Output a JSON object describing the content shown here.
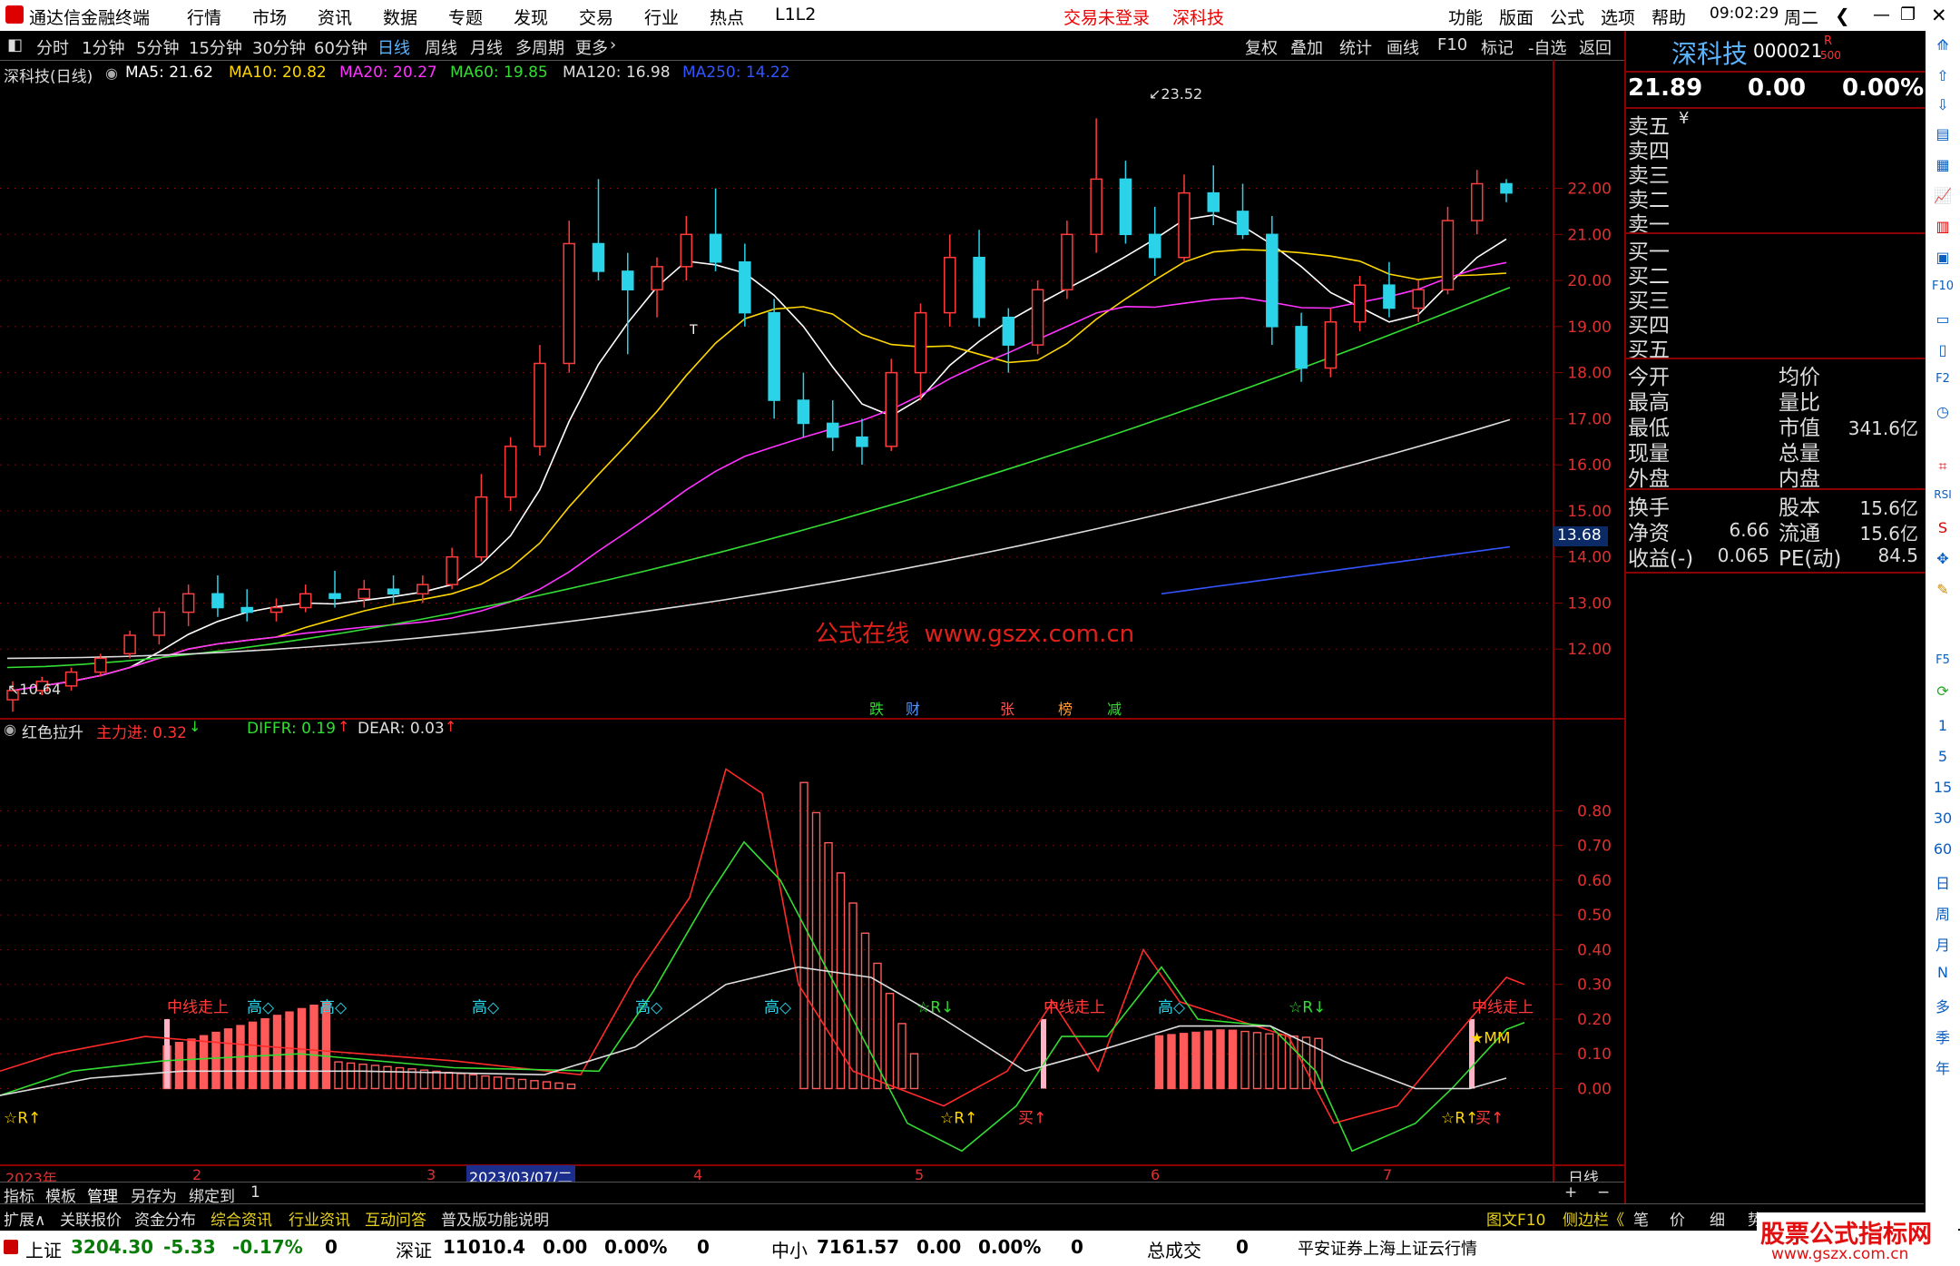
{
  "topbar": {
    "app_title": "通达信金融终端",
    "menus": [
      "行情",
      "市场",
      "资讯",
      "数据",
      "专题",
      "发现",
      "交易",
      "行业",
      "热点",
      "L1L2"
    ],
    "login_status": "交易未登录",
    "stock_name": "深科技",
    "right_menus": [
      "功能",
      "版面",
      "公式",
      "选项",
      "帮助"
    ],
    "time": "09:02:29",
    "weekday": "周二"
  },
  "periodbar": {
    "periods": [
      "分时",
      "1分钟",
      "5分钟",
      "15分钟",
      "30分钟",
      "60分钟",
      "日线",
      "周线",
      "月线",
      "多周期",
      "更多"
    ],
    "active": "日线",
    "tools": [
      "复权",
      "叠加",
      "统计",
      "画线",
      "F10",
      "标记",
      "-自选",
      "返回"
    ]
  },
  "main_chart": {
    "title": "深科技(日线)",
    "ma_legend": [
      {
        "label": "MA5: 21.62",
        "color": "#ffffff"
      },
      {
        "label": "MA10: 20.82",
        "color": "#ffd700"
      },
      {
        "label": "MA20: 20.27",
        "color": "#ff33ff"
      },
      {
        "label": "MA60: 19.85",
        "color": "#33dd33"
      },
      {
        "label": "MA120: 16.98",
        "color": "#dddddd"
      },
      {
        "label": "MA250: 14.22",
        "color": "#3355ff"
      }
    ],
    "high_label": "23.52",
    "low_label": "10.64",
    "current_price_tag": "13.68",
    "watermark": "公式在线  www.gszx.com.cn",
    "event_tags": [
      {
        "text": "跌",
        "color": "#33dd33"
      },
      {
        "text": "财",
        "color": "#5599ff"
      },
      {
        "text": "张",
        "color": "#ff5555"
      },
      {
        "text": "榜",
        "color": "#ff9933"
      },
      {
        "text": "减",
        "color": "#33dd33"
      }
    ],
    "t_marker": "T"
  },
  "chart_data": [
    {
      "type": "candlestick",
      "title": "深科技(日线)",
      "ylim": [
        11.0,
        24.0
      ],
      "y_ticks": [
        "22.00",
        "21.00",
        "20.00",
        "19.00",
        "18.00",
        "17.00",
        "16.00",
        "15.00",
        "14.00",
        "13.00",
        "12.00"
      ],
      "candles_approx": [
        {
          "o": 10.9,
          "h": 11.3,
          "l": 10.64,
          "c": 11.1
        },
        {
          "o": 11.1,
          "h": 11.4,
          "l": 11.0,
          "c": 11.3
        },
        {
          "o": 11.2,
          "h": 11.6,
          "l": 11.1,
          "c": 11.5
        },
        {
          "o": 11.5,
          "h": 11.9,
          "l": 11.4,
          "c": 11.8
        },
        {
          "o": 11.9,
          "h": 12.4,
          "l": 11.8,
          "c": 12.3
        },
        {
          "o": 12.3,
          "h": 12.9,
          "l": 12.1,
          "c": 12.8
        },
        {
          "o": 12.8,
          "h": 13.4,
          "l": 12.5,
          "c": 13.2
        },
        {
          "o": 13.2,
          "h": 13.6,
          "l": 12.7,
          "c": 12.9
        },
        {
          "o": 12.9,
          "h": 13.3,
          "l": 12.6,
          "c": 12.8
        },
        {
          "o": 12.8,
          "h": 13.1,
          "l": 12.6,
          "c": 12.9
        },
        {
          "o": 12.9,
          "h": 13.4,
          "l": 12.8,
          "c": 13.2
        },
        {
          "o": 13.2,
          "h": 13.7,
          "l": 12.9,
          "c": 13.1
        },
        {
          "o": 13.1,
          "h": 13.5,
          "l": 12.9,
          "c": 13.3
        },
        {
          "o": 13.3,
          "h": 13.6,
          "l": 13.0,
          "c": 13.2
        },
        {
          "o": 13.2,
          "h": 13.6,
          "l": 13.0,
          "c": 13.4
        },
        {
          "o": 13.4,
          "h": 14.2,
          "l": 13.3,
          "c": 14.0
        },
        {
          "o": 14.0,
          "h": 15.8,
          "l": 13.9,
          "c": 15.3
        },
        {
          "o": 15.3,
          "h": 16.6,
          "l": 15.0,
          "c": 16.4
        },
        {
          "o": 16.4,
          "h": 18.6,
          "l": 16.2,
          "c": 18.2
        },
        {
          "o": 18.2,
          "h": 21.3,
          "l": 18.0,
          "c": 20.8
        },
        {
          "o": 20.8,
          "h": 22.2,
          "l": 20.0,
          "c": 20.2
        },
        {
          "o": 20.2,
          "h": 20.6,
          "l": 18.4,
          "c": 19.8
        },
        {
          "o": 19.8,
          "h": 20.5,
          "l": 19.2,
          "c": 20.3
        },
        {
          "o": 20.3,
          "h": 21.4,
          "l": 20.0,
          "c": 21.0
        },
        {
          "o": 21.0,
          "h": 22.0,
          "l": 20.2,
          "c": 20.4
        },
        {
          "o": 20.4,
          "h": 20.8,
          "l": 19.0,
          "c": 19.3
        },
        {
          "o": 19.3,
          "h": 19.6,
          "l": 17.0,
          "c": 17.4
        },
        {
          "o": 17.4,
          "h": 18.0,
          "l": 16.6,
          "c": 16.9
        },
        {
          "o": 16.9,
          "h": 17.4,
          "l": 16.3,
          "c": 16.6
        },
        {
          "o": 16.6,
          "h": 17.0,
          "l": 16.0,
          "c": 16.4
        },
        {
          "o": 16.4,
          "h": 18.3,
          "l": 16.3,
          "c": 18.0
        },
        {
          "o": 18.0,
          "h": 19.5,
          "l": 17.4,
          "c": 19.3
        },
        {
          "o": 19.3,
          "h": 21.0,
          "l": 19.0,
          "c": 20.5
        },
        {
          "o": 20.5,
          "h": 21.1,
          "l": 19.0,
          "c": 19.2
        },
        {
          "o": 19.2,
          "h": 19.4,
          "l": 18.0,
          "c": 18.6
        },
        {
          "o": 18.6,
          "h": 20.0,
          "l": 18.4,
          "c": 19.8
        },
        {
          "o": 19.8,
          "h": 21.3,
          "l": 19.6,
          "c": 21.0
        },
        {
          "o": 21.0,
          "h": 23.52,
          "l": 20.6,
          "c": 22.2
        },
        {
          "o": 22.2,
          "h": 22.6,
          "l": 20.8,
          "c": 21.0
        },
        {
          "o": 21.0,
          "h": 21.6,
          "l": 20.1,
          "c": 20.5
        },
        {
          "o": 20.5,
          "h": 22.3,
          "l": 20.4,
          "c": 21.9
        },
        {
          "o": 21.9,
          "h": 22.5,
          "l": 21.2,
          "c": 21.5
        },
        {
          "o": 21.5,
          "h": 22.1,
          "l": 20.9,
          "c": 21.0
        },
        {
          "o": 21.0,
          "h": 21.4,
          "l": 18.6,
          "c": 19.0
        },
        {
          "o": 19.0,
          "h": 19.3,
          "l": 17.8,
          "c": 18.1
        },
        {
          "o": 18.1,
          "h": 19.4,
          "l": 17.9,
          "c": 19.1
        },
        {
          "o": 19.1,
          "h": 20.1,
          "l": 18.9,
          "c": 19.9
        },
        {
          "o": 19.9,
          "h": 20.4,
          "l": 19.2,
          "c": 19.4
        },
        {
          "o": 19.4,
          "h": 20.0,
          "l": 19.1,
          "c": 19.8
        },
        {
          "o": 19.8,
          "h": 21.6,
          "l": 19.7,
          "c": 21.3
        },
        {
          "o": 21.3,
          "h": 22.4,
          "l": 21.0,
          "c": 22.1
        },
        {
          "o": 22.1,
          "h": 22.2,
          "l": 21.7,
          "c": 21.9
        }
      ],
      "series": [
        {
          "name": "MA5",
          "color": "#ffffff"
        },
        {
          "name": "MA10",
          "color": "#ffd700"
        },
        {
          "name": "MA20",
          "color": "#ff33ff"
        },
        {
          "name": "MA60",
          "color": "#33dd33"
        },
        {
          "name": "MA120",
          "color": "#dddddd"
        },
        {
          "name": "MA250",
          "color": "#3355ff"
        }
      ]
    },
    {
      "type": "bar",
      "title": "红色拉升",
      "ylim": [
        -0.2,
        0.95
      ],
      "y_ticks": [
        "0.80",
        "0.70",
        "0.60",
        "0.50",
        "0.40",
        "0.30",
        "0.20",
        "0.10",
        "0.00"
      ],
      "legend": [
        {
          "label": "主力进: 0.32",
          "color": "#ff3333"
        },
        {
          "label": "DIFFR: 0.19",
          "color": "#33dd33"
        },
        {
          "label": "DEAR: 0.03",
          "color": "#dddddd"
        }
      ],
      "signal_labels": [
        "中线走上",
        "高◇",
        "高◇",
        "高◇",
        "高◇",
        "高◇",
        "☆R↓",
        "中线走上",
        "高◇",
        "☆R↓",
        "中线走上",
        "★MM",
        "☆R↑",
        "☆R↑",
        "买↑",
        "☆R↑",
        "买↑"
      ]
    }
  ],
  "time_axis": {
    "labels": [
      "2023年",
      "2",
      "3",
      "4",
      "5",
      "6",
      "7"
    ],
    "cursor_date": "2023/03/07/二",
    "period_label": "日线"
  },
  "bar1": {
    "items": [
      "指标",
      "模板",
      "管理",
      "另存为",
      "绑定到",
      "1"
    ],
    "zoom": [
      "+",
      "−"
    ]
  },
  "bar2": {
    "items": [
      "扩展∧",
      "关联报价",
      "资金分布",
      "综合资讯",
      "行业资讯",
      "互动问答",
      "普及版功能说明"
    ],
    "right_items": [
      "图文F10",
      "侧边栏《",
      "笔",
      "价",
      "细",
      "势"
    ]
  },
  "status_bar": {
    "indices": [
      {
        "name": "上证",
        "value": "3204.30",
        "change": "-5.33",
        "pct": "-0.17%",
        "vol": "0"
      },
      {
        "name": "深证",
        "value": "11010.4",
        "change": "0.00",
        "pct": "0.00%",
        "vol": "0"
      },
      {
        "name": "中小",
        "value": "7161.57",
        "change": "0.00",
        "pct": "0.00%",
        "vol": "0"
      }
    ],
    "total_label": "总成交",
    "total_value": "0",
    "server": "平安证券上海上证云行情",
    "brand": "股票公式指标网",
    "brand_url": "www.gszx.com.cn"
  },
  "quote_panel": {
    "name": "深科技",
    "code": "000021",
    "badge_r": "R",
    "badge_500": "500",
    "price": "21.89",
    "change": "0.00",
    "pct": "0.00%",
    "asks": [
      "卖五",
      "卖四",
      "卖三",
      "卖二",
      "卖一"
    ],
    "ask_unit": "¥",
    "bids": [
      "买一",
      "买二",
      "买三",
      "买四",
      "买五"
    ],
    "fields_left": [
      "今开",
      "最高",
      "最低",
      "现量",
      "外盘"
    ],
    "fields_right": [
      "均价",
      "量比",
      "市值",
      "总量",
      "内盘"
    ],
    "market_cap": "341.6亿",
    "fin_left": [
      {
        "label": "换手",
        "value": ""
      },
      {
        "label": "净资",
        "value": "6.66"
      },
      {
        "label": "收益(-)",
        "value": "0.065"
      }
    ],
    "fin_right": [
      {
        "label": "股本",
        "value": "15.6亿"
      },
      {
        "label": "流通",
        "value": "15.6亿"
      },
      {
        "label": "PE(动)",
        "value": "84.5"
      }
    ]
  },
  "side_icons": [
    "1",
    "5",
    "15",
    "30",
    "60",
    "日",
    "周",
    "月",
    "N",
    "多",
    "季",
    "年"
  ]
}
